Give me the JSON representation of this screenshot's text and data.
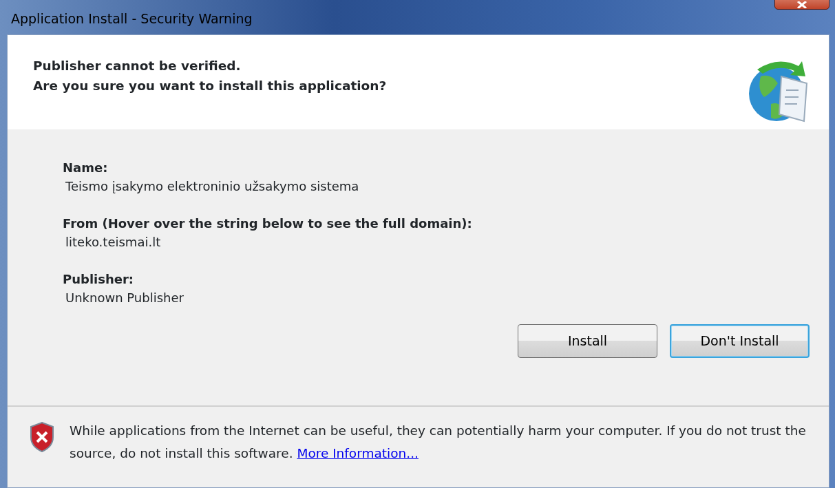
{
  "window": {
    "title": "Application Install - Security Warning"
  },
  "header": {
    "lines": [
      "Publisher cannot be verified.",
      "Are you sure you want to install this application?"
    ]
  },
  "fields": [
    {
      "label": "Name:",
      "value": "Teismo įsakymo elektroninio užsakymo sistema"
    },
    {
      "label": "From (Hover over the string below to see the full domain):",
      "value": "liteko.teismai.lt"
    },
    {
      "label": "Publisher:",
      "value": "Unknown Publisher"
    }
  ],
  "buttons": [
    {
      "label": "Install",
      "focused": false
    },
    {
      "label": "Don't Install",
      "focused": true
    }
  ],
  "footer": {
    "text": "While applications from the Internet can be useful, they can potentially harm your computer. If you do not trust the source, do not install this software.",
    "link": "More Information..."
  }
}
